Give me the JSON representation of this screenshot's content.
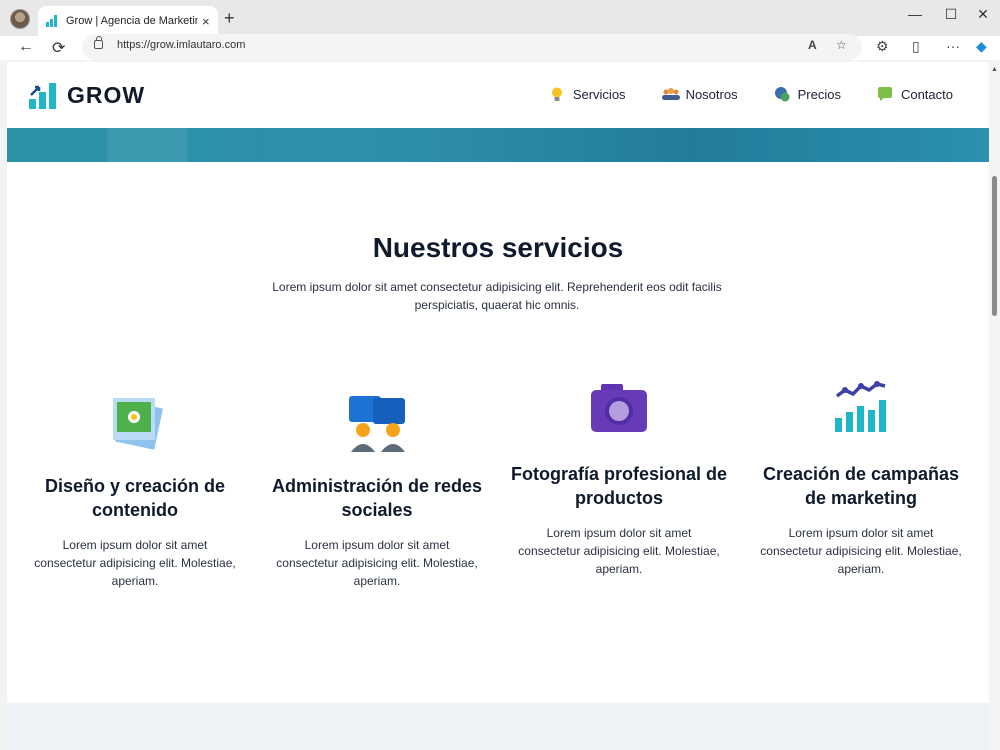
{
  "browser": {
    "tab_title": "Grow | Agencia de Marketing Dig",
    "url": "https://grow.imlautaro.com",
    "new_tab": "+",
    "tab_close": "×",
    "back": "←",
    "reload": "⟳",
    "read_aloud": "A",
    "favorite": "☆",
    "win_minimize": "—",
    "win_maximize": "☐",
    "win_close": "✕",
    "menu": "···"
  },
  "site": {
    "logo_text": "GROW",
    "nav": [
      {
        "label": "Servicios",
        "icon": "lightbulb-icon"
      },
      {
        "label": "Nosotros",
        "icon": "people-icon"
      },
      {
        "label": "Precios",
        "icon": "money-icon"
      },
      {
        "label": "Contacto",
        "icon": "chat-icon"
      }
    ]
  },
  "services": {
    "title": "Nuestros servicios",
    "subtitle": "Lorem ipsum dolor sit amet consectetur adipisicing elit. Reprehenderit eos odit facilis perspiciatis, quaerat hic omnis.",
    "cards": [
      {
        "title": "Diseño y creación de contenido",
        "text": "Lorem ipsum dolor sit amet consectetur adipisicing elit. Molestiae, aperiam.",
        "icon": "photos-icon"
      },
      {
        "title": "Administración de redes sociales",
        "text": "Lorem ipsum dolor sit amet consectetur adipisicing elit. Molestiae, aperiam.",
        "icon": "social-icon"
      },
      {
        "title": "Fotografía profesional de productos",
        "text": "Lorem ipsum dolor sit amet consectetur adipisicing elit. Molestiae, aperiam.",
        "icon": "camera-icon"
      },
      {
        "title": "Creación de campañas de marketing",
        "text": "Lorem ipsum dolor sit amet consectetur adipisicing elit. Molestiae, aperiam.",
        "icon": "chart-icon"
      }
    ]
  },
  "colors": {
    "accent": "#1fb6c9",
    "heading": "#0f1a2c",
    "hero": "#2a8fab"
  }
}
